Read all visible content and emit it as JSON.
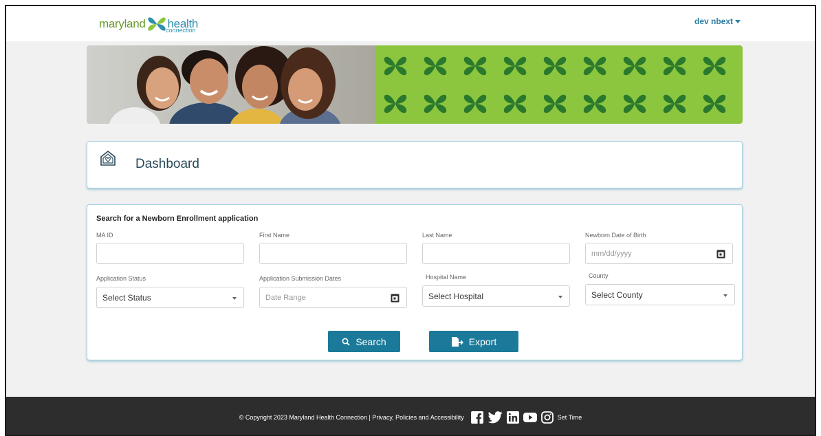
{
  "header": {
    "logo": {
      "word1": "maryland",
      "word2": "health",
      "word3": "connection"
    },
    "user_name": "dev nbext"
  },
  "banner": {
    "pattern_color": "#8cc63f"
  },
  "dashboard": {
    "title": "Dashboard"
  },
  "search": {
    "heading": "Search for a Newborn Enrollment application",
    "fields": {
      "ma_id": {
        "label": "MA ID",
        "value": ""
      },
      "first_name": {
        "label": "First Name",
        "value": ""
      },
      "last_name": {
        "label": "Last Name",
        "value": ""
      },
      "dob": {
        "label": "Newborn Date of Birth",
        "placeholder": "mm/dd/yyyy"
      },
      "app_status": {
        "label": "Application Status",
        "selected": "Select Status"
      },
      "submission_dates": {
        "label": "Application Submission Dates",
        "placeholder": "Date Range"
      },
      "hospital": {
        "label": "Hospital Name",
        "selected": "Select Hospital"
      },
      "county": {
        "label": "County",
        "selected": "Select County"
      }
    },
    "buttons": {
      "search": "Search",
      "export": "Export"
    }
  },
  "footer": {
    "copyright": "© Copyright 2023 Maryland Health Connection | Privacy, Policies and Accessibility",
    "set_time": "Set Time",
    "social_icons": [
      "facebook-icon",
      "twitter-icon",
      "linkedin-icon",
      "youtube-icon",
      "instagram-icon"
    ]
  },
  "colors": {
    "accent": "#1b7a99",
    "brand_green": "#8cc63f",
    "footer_bg": "#2d2d2d"
  }
}
